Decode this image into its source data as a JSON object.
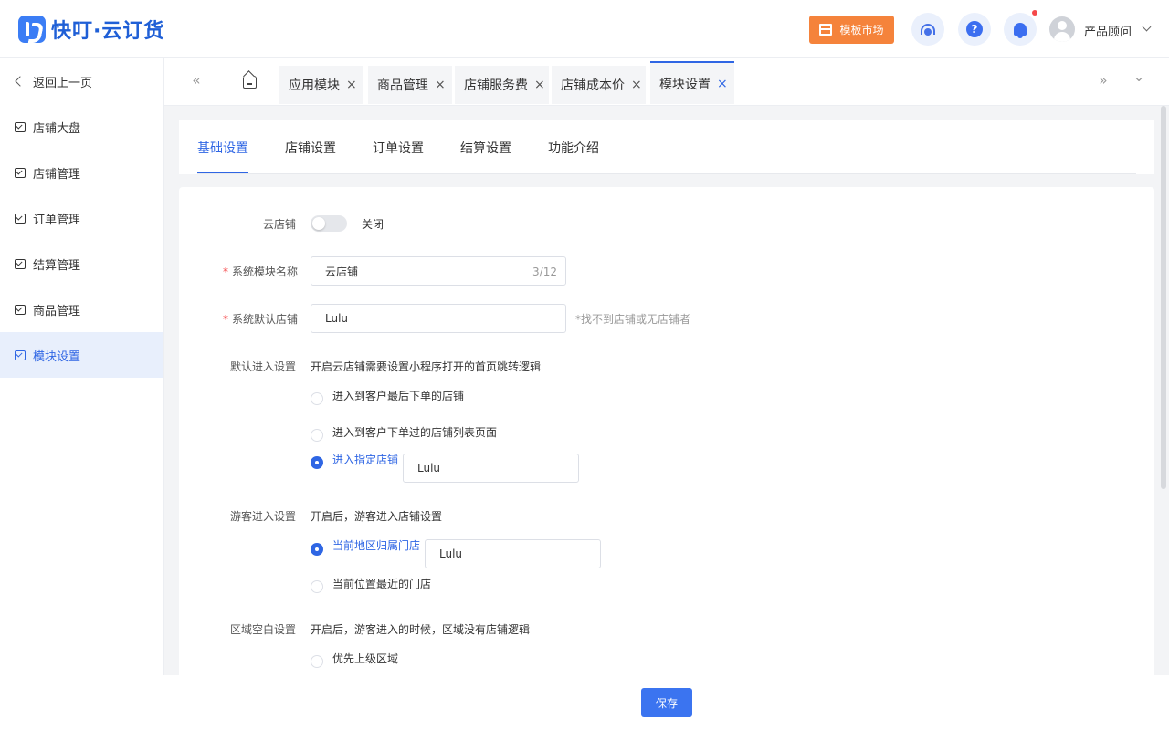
{
  "app": {
    "logo_text": "快叮·云订货"
  },
  "header": {
    "template_market": "模板市场",
    "help_glyph": "?",
    "user_name": "产品顾问",
    "accent": "#2f66e4",
    "template_btn_color": "#f5833b"
  },
  "sidebar": {
    "back": "返回上一页",
    "items": [
      {
        "label": "店铺大盘"
      },
      {
        "label": "店铺管理"
      },
      {
        "label": "订单管理"
      },
      {
        "label": "结算管理"
      },
      {
        "label": "商品管理"
      },
      {
        "label": "模块设置",
        "active": true
      }
    ]
  },
  "tabs": {
    "left_arrow": "«",
    "right_arrow": "»",
    "dropdown": "⌄",
    "close_glyph": "×",
    "items": [
      {
        "label": "应用模块"
      },
      {
        "label": "商品管理"
      },
      {
        "label": "店铺服务费"
      },
      {
        "label": "店铺成本价"
      },
      {
        "label": "模块设置",
        "active": true
      }
    ]
  },
  "subtabs": {
    "items": [
      {
        "label": "基础设置",
        "active": true
      },
      {
        "label": "店铺设置"
      },
      {
        "label": "订单设置"
      },
      {
        "label": "结算设置"
      },
      {
        "label": "功能介绍"
      }
    ]
  },
  "form": {
    "cloud_store": {
      "label": "云店铺",
      "state": "关闭",
      "enabled": false
    },
    "module_name": {
      "required_mark": "*",
      "label": "系统模块名称",
      "value": "云店铺",
      "counter": "3/12"
    },
    "default_store": {
      "required_mark": "*",
      "label": "系统默认店铺",
      "value": "Lulu",
      "hint": "*找不到店铺或无店铺者"
    },
    "default_entry": {
      "label": "默认进入设置",
      "description": "开启云店铺需要设置小程序打开的首页跳转逻辑",
      "options": [
        {
          "label": "进入到客户最后下单的店铺",
          "selected": false
        },
        {
          "label": "进入到客户下单过的店铺列表页面",
          "selected": false
        },
        {
          "label": "进入指定店铺",
          "selected": true,
          "value": "Lulu"
        }
      ]
    },
    "guest_entry": {
      "label": "游客进入设置",
      "description": "开启后，游客进入店铺设置",
      "options": [
        {
          "label": "当前地区归属门店",
          "selected": true,
          "value": "Lulu"
        },
        {
          "label": "当前位置最近的门店",
          "selected": false
        }
      ]
    },
    "region_blank": {
      "label": "区域空白设置",
      "description": "开启后，游客进入的时候，区域没有店铺逻辑",
      "options": [
        {
          "label": "优先上级区域",
          "selected": false
        }
      ]
    }
  },
  "footer": {
    "save": "保存"
  }
}
